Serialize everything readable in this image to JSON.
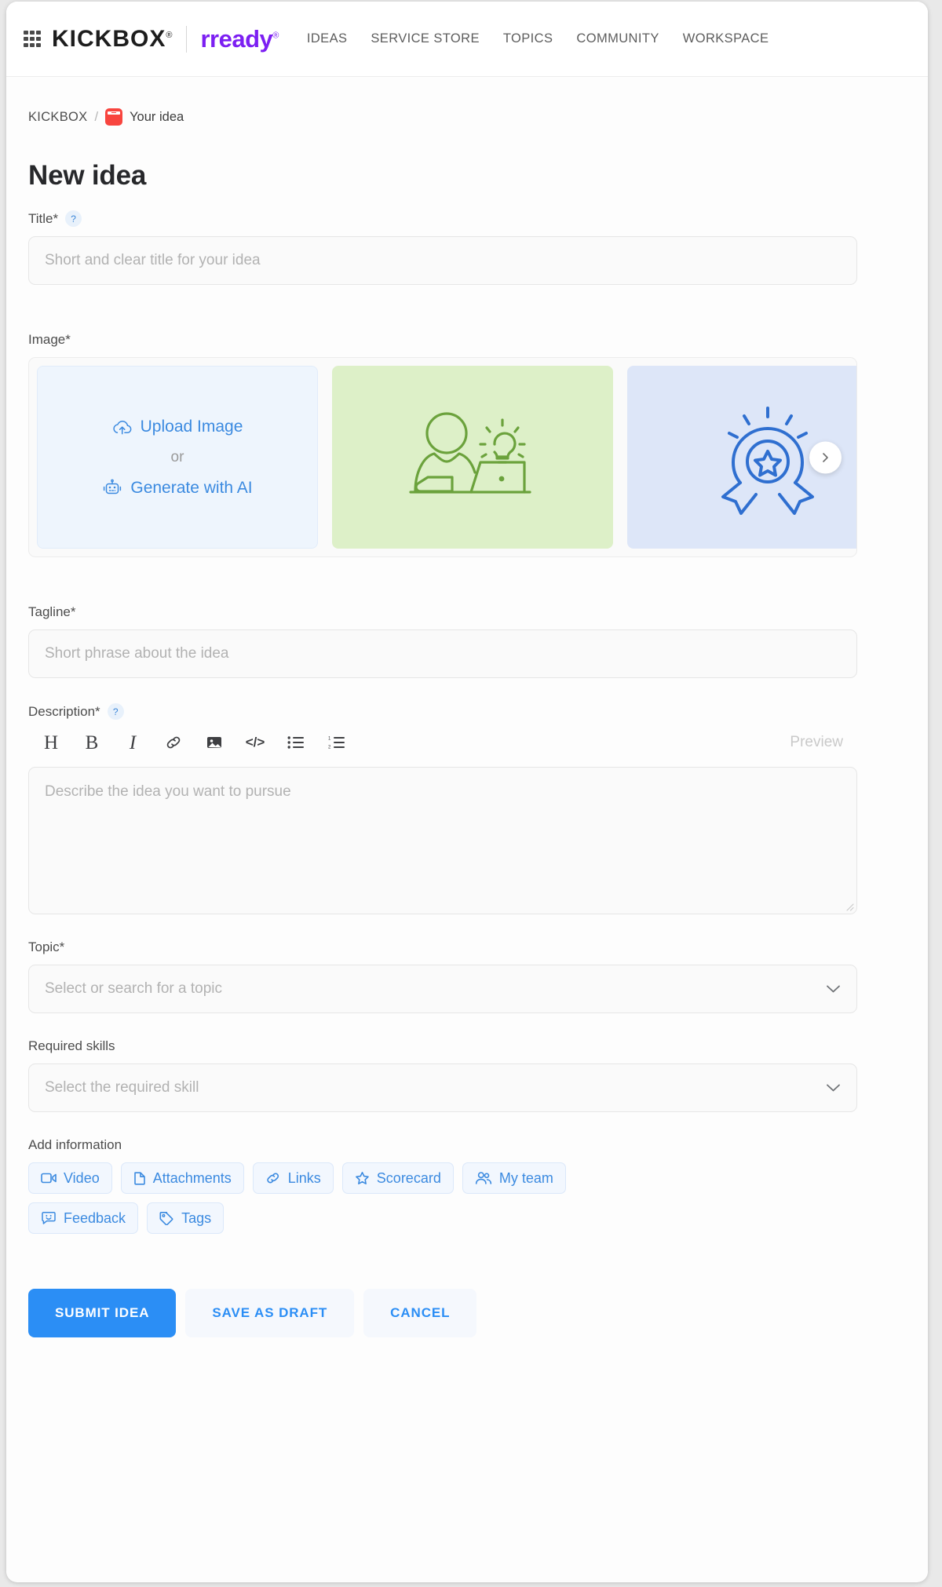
{
  "header": {
    "app_launcher_icon": "grid-icon",
    "brand_primary": "KICKBOX",
    "brand_primary_mark": "®",
    "brand_secondary": "rready",
    "brand_secondary_mark": "®",
    "nav": [
      {
        "label": "IDEAS"
      },
      {
        "label": "SERVICE STORE"
      },
      {
        "label": "TOPICS"
      },
      {
        "label": "COMMUNITY"
      },
      {
        "label": "WORKSPACE"
      }
    ]
  },
  "breadcrumb": {
    "root": "KICKBOX",
    "separator": "/",
    "current": "Your idea",
    "current_icon": "red-box-icon"
  },
  "page_title": "New idea",
  "form": {
    "title": {
      "label": "Title*",
      "help_icon": "question-mark-icon",
      "help_glyph": "?",
      "value": "",
      "placeholder": "Short and clear title for your idea"
    },
    "image": {
      "label": "Image*",
      "upload_label": "Upload Image",
      "upload_icon": "cloud-upload-icon",
      "or_label": "or",
      "generate_label": "Generate with AI",
      "generate_icon": "robot-icon",
      "next_icon": "chevron-right-icon",
      "cards": [
        {
          "name": "upload-card",
          "type": "upload",
          "color": "#eef5fd"
        },
        {
          "name": "illustration-person-laptop-idea",
          "type": "illustration",
          "color": "#ddf0c8",
          "stroke": "#6ba23c"
        },
        {
          "name": "illustration-award-badge-star",
          "type": "illustration",
          "color": "#dde6f8",
          "stroke": "#2f6fd0"
        }
      ]
    },
    "tagline": {
      "label": "Tagline*",
      "value": "",
      "placeholder": "Short phrase about the idea"
    },
    "description": {
      "label": "Description*",
      "help_icon": "question-mark-icon",
      "help_glyph": "?",
      "value": "",
      "placeholder": "Describe the idea you want to pursue",
      "preview_label": "Preview",
      "toolbar": [
        {
          "name": "heading-icon",
          "glyph": "H"
        },
        {
          "name": "bold-icon",
          "glyph": "B"
        },
        {
          "name": "italic-icon",
          "glyph": "I"
        },
        {
          "name": "link-icon",
          "glyph": ""
        },
        {
          "name": "image-icon",
          "glyph": ""
        },
        {
          "name": "code-icon",
          "glyph": "</>"
        },
        {
          "name": "bullet-list-icon",
          "glyph": ""
        },
        {
          "name": "numbered-list-icon",
          "glyph": ""
        }
      ]
    },
    "topic": {
      "label": "Topic*",
      "value": "",
      "placeholder": "Select or search for a topic",
      "chevron_icon": "chevron-down-icon"
    },
    "required_skills": {
      "label": "Required skills",
      "value": "",
      "placeholder": "Select the required skill",
      "chevron_icon": "chevron-down-icon"
    },
    "add_information": {
      "label": "Add information",
      "chips_row_1": [
        {
          "label": "Video",
          "icon": "video-camera-icon"
        },
        {
          "label": "Attachments",
          "icon": "file-icon"
        },
        {
          "label": "Links",
          "icon": "link-chain-icon"
        },
        {
          "label": "Scorecard",
          "icon": "star-icon"
        },
        {
          "label": "My team",
          "icon": "people-icon"
        }
      ],
      "chips_row_2": [
        {
          "label": "Feedback",
          "icon": "feedback-smiley-icon"
        },
        {
          "label": "Tags",
          "icon": "tag-icon"
        }
      ]
    }
  },
  "actions": {
    "submit": "SUBMIT IDEA",
    "draft": "SAVE AS DRAFT",
    "cancel": "CANCEL"
  },
  "colors": {
    "primary_blue": "#2b8ef5",
    "brand_purple": "#7c1ff2",
    "accent_red": "#f8453f",
    "green_card": "#ddf0c8",
    "blue_card": "#dde6f8"
  }
}
